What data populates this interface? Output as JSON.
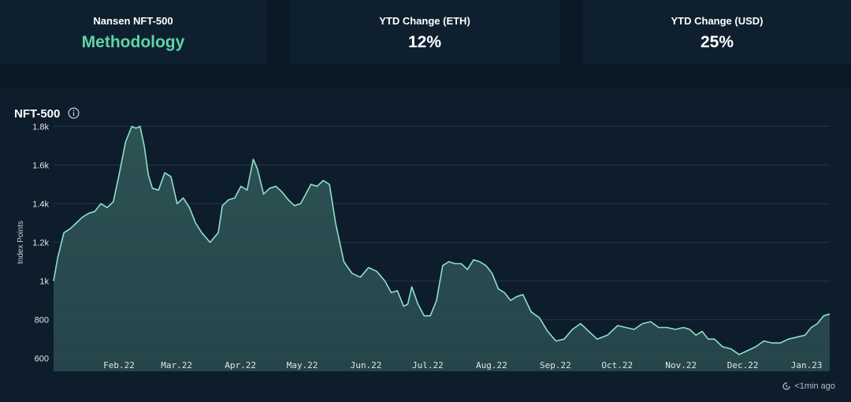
{
  "cards": [
    {
      "label": "Nansen NFT-500",
      "value": "Methodology"
    },
    {
      "label": "YTD Change (ETH)",
      "value": "12%"
    },
    {
      "label": "YTD Change (USD)",
      "value": "25%"
    }
  ],
  "panel": {
    "title": "NFT-500",
    "updated": "<1min ago"
  },
  "colors": {
    "line": "#8fe0cd",
    "fill": "#2d5254",
    "accent": "#5fd3a8",
    "grid": "#223646",
    "background": "#0e1d2b"
  },
  "icons": [
    "info-icon",
    "refresh-clock-icon"
  ],
  "chart_data": {
    "type": "area",
    "title": "NFT-500",
    "ylabel": "Index Points",
    "xlabel": "",
    "ylim": [
      550,
      1850
    ],
    "grid": true,
    "yticks": [
      {
        "value": 1800,
        "label": "1.8k"
      },
      {
        "value": 1600,
        "label": "1.6k"
      },
      {
        "value": 1400,
        "label": "1.4k"
      },
      {
        "value": 1200,
        "label": "1.2k"
      },
      {
        "value": 1000,
        "label": "1k"
      },
      {
        "value": 800,
        "label": "800"
      },
      {
        "value": 600,
        "label": "600"
      }
    ],
    "xticks": [
      {
        "date": "2022-02-01",
        "label": "Feb.22"
      },
      {
        "date": "2022-03-01",
        "label": "Mar.22"
      },
      {
        "date": "2022-04-01",
        "label": "Apr.22"
      },
      {
        "date": "2022-05-01",
        "label": "May.22"
      },
      {
        "date": "2022-06-01",
        "label": "Jun.22"
      },
      {
        "date": "2022-07-01",
        "label": "Jul.22"
      },
      {
        "date": "2022-08-01",
        "label": "Aug.22"
      },
      {
        "date": "2022-09-01",
        "label": "Sep.22"
      },
      {
        "date": "2022-10-01",
        "label": "Oct.22"
      },
      {
        "date": "2022-11-01",
        "label": "Nov.22"
      },
      {
        "date": "2022-12-01",
        "label": "Dec.22"
      },
      {
        "date": "2023-01-01",
        "label": "Jan.23"
      }
    ],
    "x": [
      "2022-01-01",
      "2022-01-03",
      "2022-01-06",
      "2022-01-09",
      "2022-01-12",
      "2022-01-15",
      "2022-01-18",
      "2022-01-21",
      "2022-01-24",
      "2022-01-27",
      "2022-01-30",
      "2022-02-02",
      "2022-02-05",
      "2022-02-08",
      "2022-02-10",
      "2022-02-12",
      "2022-02-14",
      "2022-02-16",
      "2022-02-18",
      "2022-02-21",
      "2022-02-24",
      "2022-02-27",
      "2022-03-02",
      "2022-03-05",
      "2022-03-08",
      "2022-03-11",
      "2022-03-14",
      "2022-03-18",
      "2022-03-22",
      "2022-03-24",
      "2022-03-27",
      "2022-03-30",
      "2022-04-02",
      "2022-04-05",
      "2022-04-08",
      "2022-04-10",
      "2022-04-13",
      "2022-04-16",
      "2022-04-19",
      "2022-04-22",
      "2022-04-25",
      "2022-04-28",
      "2022-05-01",
      "2022-05-03",
      "2022-05-06",
      "2022-05-09",
      "2022-05-12",
      "2022-05-15",
      "2022-05-18",
      "2022-05-22",
      "2022-05-26",
      "2022-05-30",
      "2022-06-03",
      "2022-06-07",
      "2022-06-11",
      "2022-06-14",
      "2022-06-17",
      "2022-06-20",
      "2022-06-22",
      "2022-06-24",
      "2022-06-27",
      "2022-06-30",
      "2022-07-03",
      "2022-07-06",
      "2022-07-09",
      "2022-07-12",
      "2022-07-15",
      "2022-07-18",
      "2022-07-21",
      "2022-07-24",
      "2022-07-27",
      "2022-07-30",
      "2022-08-02",
      "2022-08-05",
      "2022-08-08",
      "2022-08-11",
      "2022-08-14",
      "2022-08-17",
      "2022-08-21",
      "2022-08-25",
      "2022-08-29",
      "2022-09-02",
      "2022-09-06",
      "2022-09-10",
      "2022-09-14",
      "2022-09-18",
      "2022-09-22",
      "2022-09-27",
      "2022-10-02",
      "2022-10-06",
      "2022-10-10",
      "2022-10-14",
      "2022-10-18",
      "2022-10-22",
      "2022-10-26",
      "2022-10-30",
      "2022-11-03",
      "2022-11-06",
      "2022-11-09",
      "2022-11-12",
      "2022-11-15",
      "2022-11-18",
      "2022-11-22",
      "2022-11-26",
      "2022-11-30",
      "2022-12-04",
      "2022-12-08",
      "2022-12-12",
      "2022-12-16",
      "2022-12-20",
      "2022-12-24",
      "2022-12-28",
      "2023-01-01",
      "2023-01-04",
      "2023-01-07",
      "2023-01-10",
      "2023-01-13"
    ],
    "series": [
      {
        "values": [
          1000,
          1120,
          1250,
          1270,
          1300,
          1330,
          1350,
          1360,
          1400,
          1380,
          1410,
          1560,
          1720,
          1800,
          1790,
          1800,
          1700,
          1550,
          1480,
          1470,
          1560,
          1540,
          1400,
          1430,
          1380,
          1300,
          1250,
          1200,
          1250,
          1390,
          1420,
          1430,
          1490,
          1470,
          1630,
          1580,
          1450,
          1480,
          1490,
          1460,
          1420,
          1390,
          1400,
          1440,
          1500,
          1490,
          1520,
          1500,
          1300,
          1100,
          1040,
          1020,
          1070,
          1050,
          1000,
          940,
          950,
          870,
          880,
          970,
          880,
          820,
          820,
          900,
          1080,
          1100,
          1090,
          1090,
          1060,
          1110,
          1100,
          1080,
          1040,
          960,
          940,
          900,
          920,
          930,
          840,
          810,
          740,
          690,
          700,
          750,
          780,
          740,
          700,
          720,
          770,
          760,
          750,
          780,
          790,
          760,
          760,
          750,
          760,
          750,
          720,
          740,
          700,
          700,
          660,
          650,
          620,
          640,
          660,
          690,
          680,
          680,
          700,
          710,
          720,
          760,
          780,
          820,
          830
        ]
      }
    ]
  }
}
